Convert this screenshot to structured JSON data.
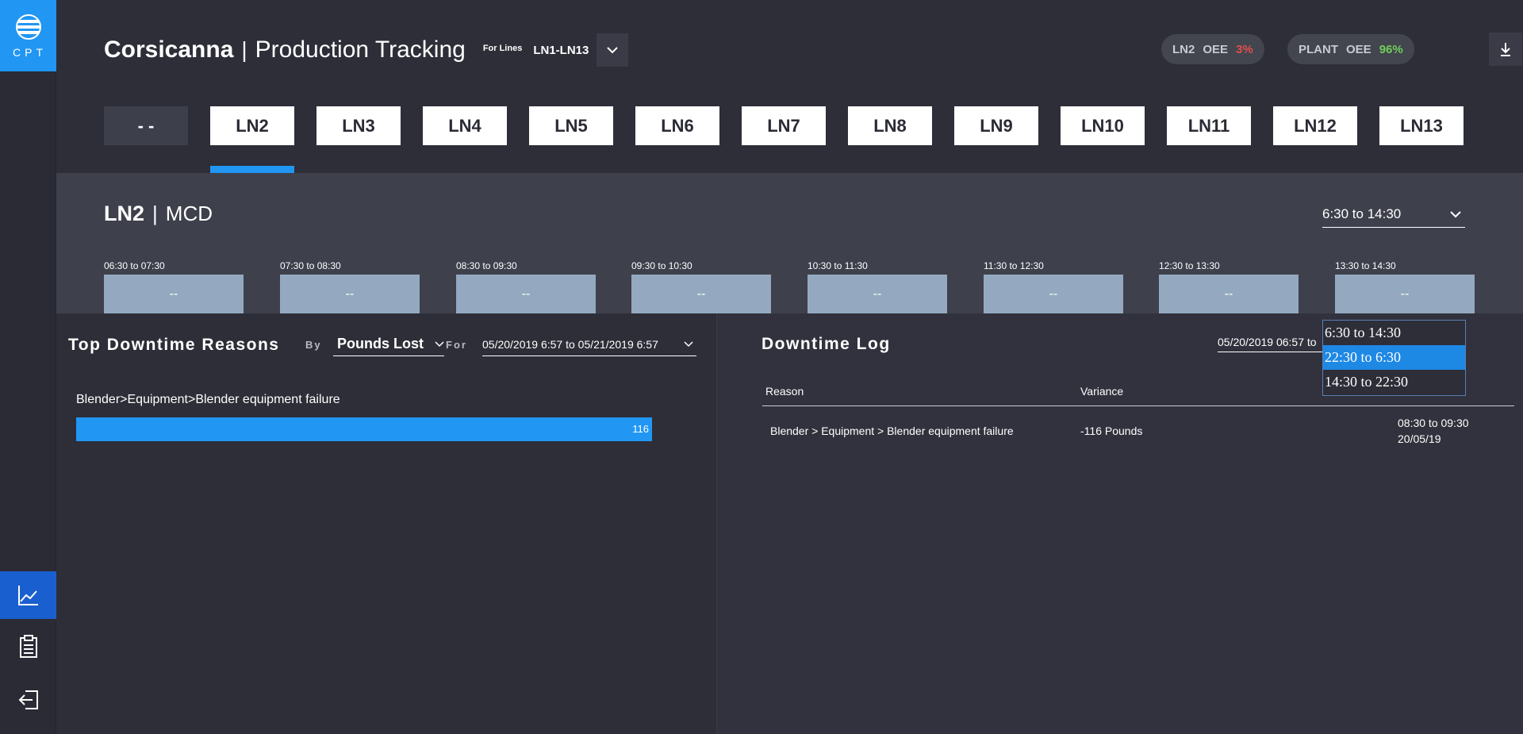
{
  "app": {
    "logo_text": "CPT"
  },
  "sidebar": {
    "items": [
      {
        "name": "chart",
        "icon": "trend-chart-icon",
        "active": true
      },
      {
        "name": "clipboard",
        "icon": "clipboard-icon",
        "active": false
      },
      {
        "name": "logout",
        "icon": "logout-icon",
        "active": false
      }
    ]
  },
  "header": {
    "plant": "Corsicanna",
    "separator": "|",
    "title": "Production Tracking",
    "for_lines_label": "For Lines",
    "lines_value": "LN1-LN13",
    "line_oee": {
      "label": "LN2",
      "metric": "OEE",
      "value": "3%"
    },
    "plant_oee": {
      "label": "PLANT",
      "metric": "OEE",
      "value": "96%"
    }
  },
  "tabs": [
    "- -",
    "LN2",
    "LN3",
    "LN4",
    "LN5",
    "LN6",
    "LN7",
    "LN8",
    "LN9",
    "LN10",
    "LN11",
    "LN12",
    "LN13"
  ],
  "active_tab": "LN2",
  "line_section": {
    "line": "LN2",
    "separator": "|",
    "product": "MCD",
    "shift": "6:30 to 14:30",
    "slots": [
      {
        "label": "06:30 to 07:30",
        "value": "--"
      },
      {
        "label": "07:30 to 08:30",
        "value": "--"
      },
      {
        "label": "08:30 to 09:30",
        "value": "--"
      },
      {
        "label": "09:30 to 10:30",
        "value": "--"
      },
      {
        "label": "10:30 to 11:30",
        "value": "--"
      },
      {
        "label": "11:30 to 12:30",
        "value": "--"
      },
      {
        "label": "12:30 to 13:30",
        "value": "--"
      },
      {
        "label": "13:30 to 14:30",
        "value": "--"
      }
    ]
  },
  "top_downtime": {
    "title": "Top Downtime Reasons",
    "by_label": "By",
    "by_value": "Pounds Lost",
    "for_label": "For",
    "date_range": "05/20/2019 6:57 to 05/21/2019 6:57",
    "reasons": [
      {
        "label": "Blender>Equipment>Blender equipment failure",
        "value": "116"
      }
    ]
  },
  "downtime_log": {
    "title": "Downtime Log",
    "date_range": "05/20/2019 06:57 to",
    "columns": [
      "Reason",
      "Variance"
    ],
    "rows": [
      {
        "reason": "Blender > Equipment > Blender equipment failure",
        "variance": "-116 Pounds",
        "time": "08:30 to 09:30",
        "date": "20/05/19"
      }
    ]
  },
  "shift_dropdown": {
    "options": [
      "6:30 to 14:30",
      "22:30 to 6:30",
      "14:30 to 22:30"
    ],
    "highlighted": "22:30 to 6:30"
  },
  "colors": {
    "accent": "#2196f3",
    "slot": "#94a9c0",
    "red": "#e0504a",
    "green": "#6fcf5a"
  }
}
